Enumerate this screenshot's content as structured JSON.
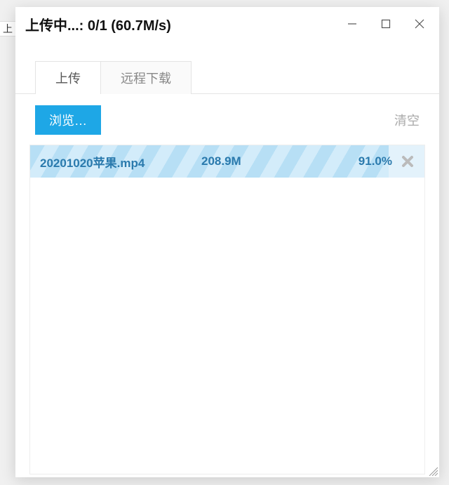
{
  "bg_tab_hint": "上",
  "window": {
    "title": "上传中...: 0/1 (60.7M/s)"
  },
  "tabs": {
    "upload": "上传",
    "remote": "远程下载"
  },
  "toolbar": {
    "browse_label": "浏览…",
    "clear_label": "清空"
  },
  "uploads": [
    {
      "name": "20201020苹果.mp4",
      "size": "208.9M",
      "percent_label": "91.0%",
      "percent": 91.0
    }
  ]
}
